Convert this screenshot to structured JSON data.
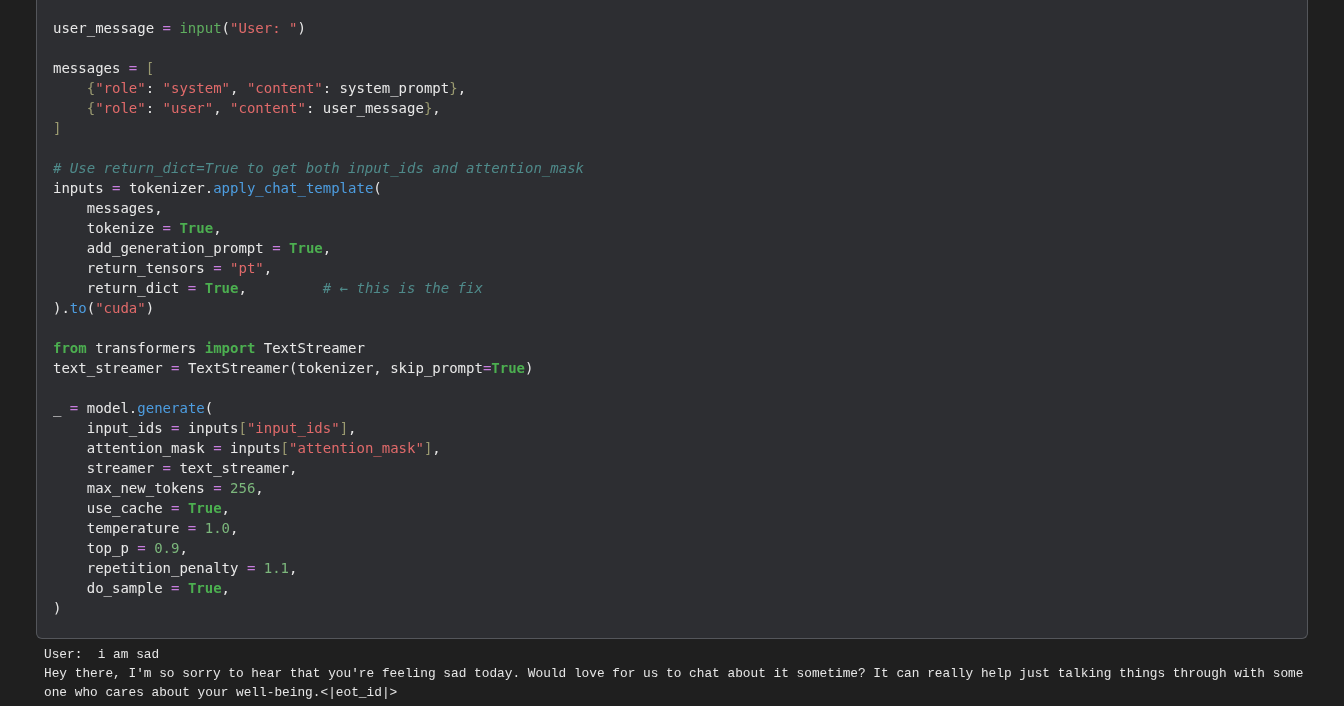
{
  "code_cell": {
    "lines": [
      {
        "kind": "code",
        "tokens": [
          {
            "kind": "plain",
            "t": "user_message "
          },
          {
            "kind": "op",
            "t": "="
          },
          {
            "kind": "builtin",
            "t": " input"
          },
          {
            "kind": "plain",
            "t": "("
          },
          {
            "kind": "string",
            "t": "\"User: \""
          },
          {
            "kind": "plain",
            "t": ")"
          }
        ]
      },
      {
        "kind": "blank"
      },
      {
        "kind": "code",
        "tokens": [
          {
            "kind": "plain",
            "t": "messages "
          },
          {
            "kind": "op",
            "t": "="
          },
          {
            "kind": "bracket",
            "t": " ["
          }
        ]
      },
      {
        "kind": "code",
        "tokens": [
          {
            "kind": "bracket",
            "t": "    {"
          },
          {
            "kind": "string",
            "t": "\"role\""
          },
          {
            "kind": "plain",
            "t": ": "
          },
          {
            "kind": "string",
            "t": "\"system\""
          },
          {
            "kind": "plain",
            "t": ", "
          },
          {
            "kind": "string",
            "t": "\"content\""
          },
          {
            "kind": "plain",
            "t": ": system_prompt"
          },
          {
            "kind": "bracket",
            "t": "}"
          },
          {
            "kind": "plain",
            "t": ","
          }
        ]
      },
      {
        "kind": "code",
        "tokens": [
          {
            "kind": "bracket",
            "t": "    {"
          },
          {
            "kind": "string",
            "t": "\"role\""
          },
          {
            "kind": "plain",
            "t": ": "
          },
          {
            "kind": "string",
            "t": "\"user\""
          },
          {
            "kind": "plain",
            "t": ", "
          },
          {
            "kind": "string",
            "t": "\"content\""
          },
          {
            "kind": "plain",
            "t": ": user_message"
          },
          {
            "kind": "bracket",
            "t": "}"
          },
          {
            "kind": "plain",
            "t": ","
          }
        ]
      },
      {
        "kind": "code",
        "tokens": [
          {
            "kind": "bracket",
            "t": "]"
          }
        ]
      },
      {
        "kind": "blank"
      },
      {
        "kind": "code",
        "tokens": [
          {
            "kind": "comment",
            "t": "# Use return_dict=True to get both input_ids and attention_mask"
          }
        ]
      },
      {
        "kind": "code",
        "tokens": [
          {
            "kind": "plain",
            "t": "inputs "
          },
          {
            "kind": "op",
            "t": "="
          },
          {
            "kind": "plain",
            "t": " tokenizer."
          },
          {
            "kind": "method",
            "t": "apply_chat_template"
          },
          {
            "kind": "plain",
            "t": "("
          }
        ]
      },
      {
        "kind": "code",
        "tokens": [
          {
            "kind": "plain",
            "t": "    messages,"
          }
        ]
      },
      {
        "kind": "code",
        "tokens": [
          {
            "kind": "plain",
            "t": "    tokenize "
          },
          {
            "kind": "op",
            "t": "="
          },
          {
            "kind": "bool",
            "t": " True"
          },
          {
            "kind": "plain",
            "t": ","
          }
        ]
      },
      {
        "kind": "code",
        "tokens": [
          {
            "kind": "plain",
            "t": "    add_generation_prompt "
          },
          {
            "kind": "op",
            "t": "="
          },
          {
            "kind": "bool",
            "t": " True"
          },
          {
            "kind": "plain",
            "t": ","
          }
        ]
      },
      {
        "kind": "code",
        "tokens": [
          {
            "kind": "plain",
            "t": "    return_tensors "
          },
          {
            "kind": "op",
            "t": "="
          },
          {
            "kind": "string",
            "t": " \"pt\""
          },
          {
            "kind": "plain",
            "t": ","
          }
        ]
      },
      {
        "kind": "code",
        "tokens": [
          {
            "kind": "plain",
            "t": "    return_dict "
          },
          {
            "kind": "op",
            "t": "="
          },
          {
            "kind": "bool",
            "t": " True"
          },
          {
            "kind": "plain",
            "t": ",         "
          },
          {
            "kind": "comment",
            "t": "# ← this is the fix"
          }
        ]
      },
      {
        "kind": "code",
        "tokens": [
          {
            "kind": "plain",
            "t": ")."
          },
          {
            "kind": "method",
            "t": "to"
          },
          {
            "kind": "plain",
            "t": "("
          },
          {
            "kind": "string",
            "t": "\"cuda\""
          },
          {
            "kind": "plain",
            "t": ")"
          }
        ]
      },
      {
        "kind": "blank"
      },
      {
        "kind": "code",
        "tokens": [
          {
            "kind": "keyword",
            "t": "from"
          },
          {
            "kind": "plain",
            "t": " transformers "
          },
          {
            "kind": "keyword",
            "t": "import"
          },
          {
            "kind": "plain",
            "t": " TextStreamer"
          }
        ]
      },
      {
        "kind": "code",
        "tokens": [
          {
            "kind": "plain",
            "t": "text_streamer "
          },
          {
            "kind": "op",
            "t": "="
          },
          {
            "kind": "plain",
            "t": " TextStreamer(tokenizer, skip_prompt"
          },
          {
            "kind": "op",
            "t": "="
          },
          {
            "kind": "bool",
            "t": "True"
          },
          {
            "kind": "plain",
            "t": ")"
          }
        ]
      },
      {
        "kind": "blank"
      },
      {
        "kind": "code",
        "tokens": [
          {
            "kind": "plain",
            "t": "_ "
          },
          {
            "kind": "op",
            "t": "="
          },
          {
            "kind": "plain",
            "t": " model."
          },
          {
            "kind": "method",
            "t": "generate"
          },
          {
            "kind": "plain",
            "t": "("
          }
        ]
      },
      {
        "kind": "code",
        "tokens": [
          {
            "kind": "plain",
            "t": "    input_ids "
          },
          {
            "kind": "op",
            "t": "="
          },
          {
            "kind": "plain",
            "t": " inputs"
          },
          {
            "kind": "bracket",
            "t": "["
          },
          {
            "kind": "string",
            "t": "\"input_ids\""
          },
          {
            "kind": "bracket",
            "t": "]"
          },
          {
            "kind": "plain",
            "t": ","
          }
        ]
      },
      {
        "kind": "code",
        "tokens": [
          {
            "kind": "plain",
            "t": "    attention_mask "
          },
          {
            "kind": "op",
            "t": "="
          },
          {
            "kind": "plain",
            "t": " inputs"
          },
          {
            "kind": "bracket",
            "t": "["
          },
          {
            "kind": "string",
            "t": "\"attention_mask\""
          },
          {
            "kind": "bracket",
            "t": "]"
          },
          {
            "kind": "plain",
            "t": ","
          }
        ]
      },
      {
        "kind": "code",
        "tokens": [
          {
            "kind": "plain",
            "t": "    streamer "
          },
          {
            "kind": "op",
            "t": "="
          },
          {
            "kind": "plain",
            "t": " text_streamer,"
          }
        ]
      },
      {
        "kind": "code",
        "tokens": [
          {
            "kind": "plain",
            "t": "    max_new_tokens "
          },
          {
            "kind": "op",
            "t": "="
          },
          {
            "kind": "number",
            "t": " 256"
          },
          {
            "kind": "plain",
            "t": ","
          }
        ]
      },
      {
        "kind": "code",
        "tokens": [
          {
            "kind": "plain",
            "t": "    use_cache "
          },
          {
            "kind": "op",
            "t": "="
          },
          {
            "kind": "bool",
            "t": " True"
          },
          {
            "kind": "plain",
            "t": ","
          }
        ]
      },
      {
        "kind": "code",
        "tokens": [
          {
            "kind": "plain",
            "t": "    temperature "
          },
          {
            "kind": "op",
            "t": "="
          },
          {
            "kind": "number",
            "t": " 1.0"
          },
          {
            "kind": "plain",
            "t": ","
          }
        ]
      },
      {
        "kind": "code",
        "tokens": [
          {
            "kind": "plain",
            "t": "    top_p "
          },
          {
            "kind": "op",
            "t": "="
          },
          {
            "kind": "number",
            "t": " 0.9"
          },
          {
            "kind": "plain",
            "t": ","
          }
        ]
      },
      {
        "kind": "code",
        "tokens": [
          {
            "kind": "plain",
            "t": "    repetition_penalty "
          },
          {
            "kind": "op",
            "t": "="
          },
          {
            "kind": "number",
            "t": " 1.1"
          },
          {
            "kind": "plain",
            "t": ","
          }
        ]
      },
      {
        "kind": "code",
        "tokens": [
          {
            "kind": "plain",
            "t": "    do_sample "
          },
          {
            "kind": "op",
            "t": "="
          },
          {
            "kind": "bool",
            "t": " True"
          },
          {
            "kind": "plain",
            "t": ","
          }
        ]
      },
      {
        "kind": "code",
        "tokens": [
          {
            "kind": "plain",
            "t": ")"
          }
        ]
      }
    ]
  },
  "output": [
    "User:  i am sad",
    "Hey there, I'm so sorry to hear that you're feeling sad today. Would love for us to chat about it sometime? It can really help just talking things through with someone who cares about your well-being.<|eot_id|>"
  ]
}
